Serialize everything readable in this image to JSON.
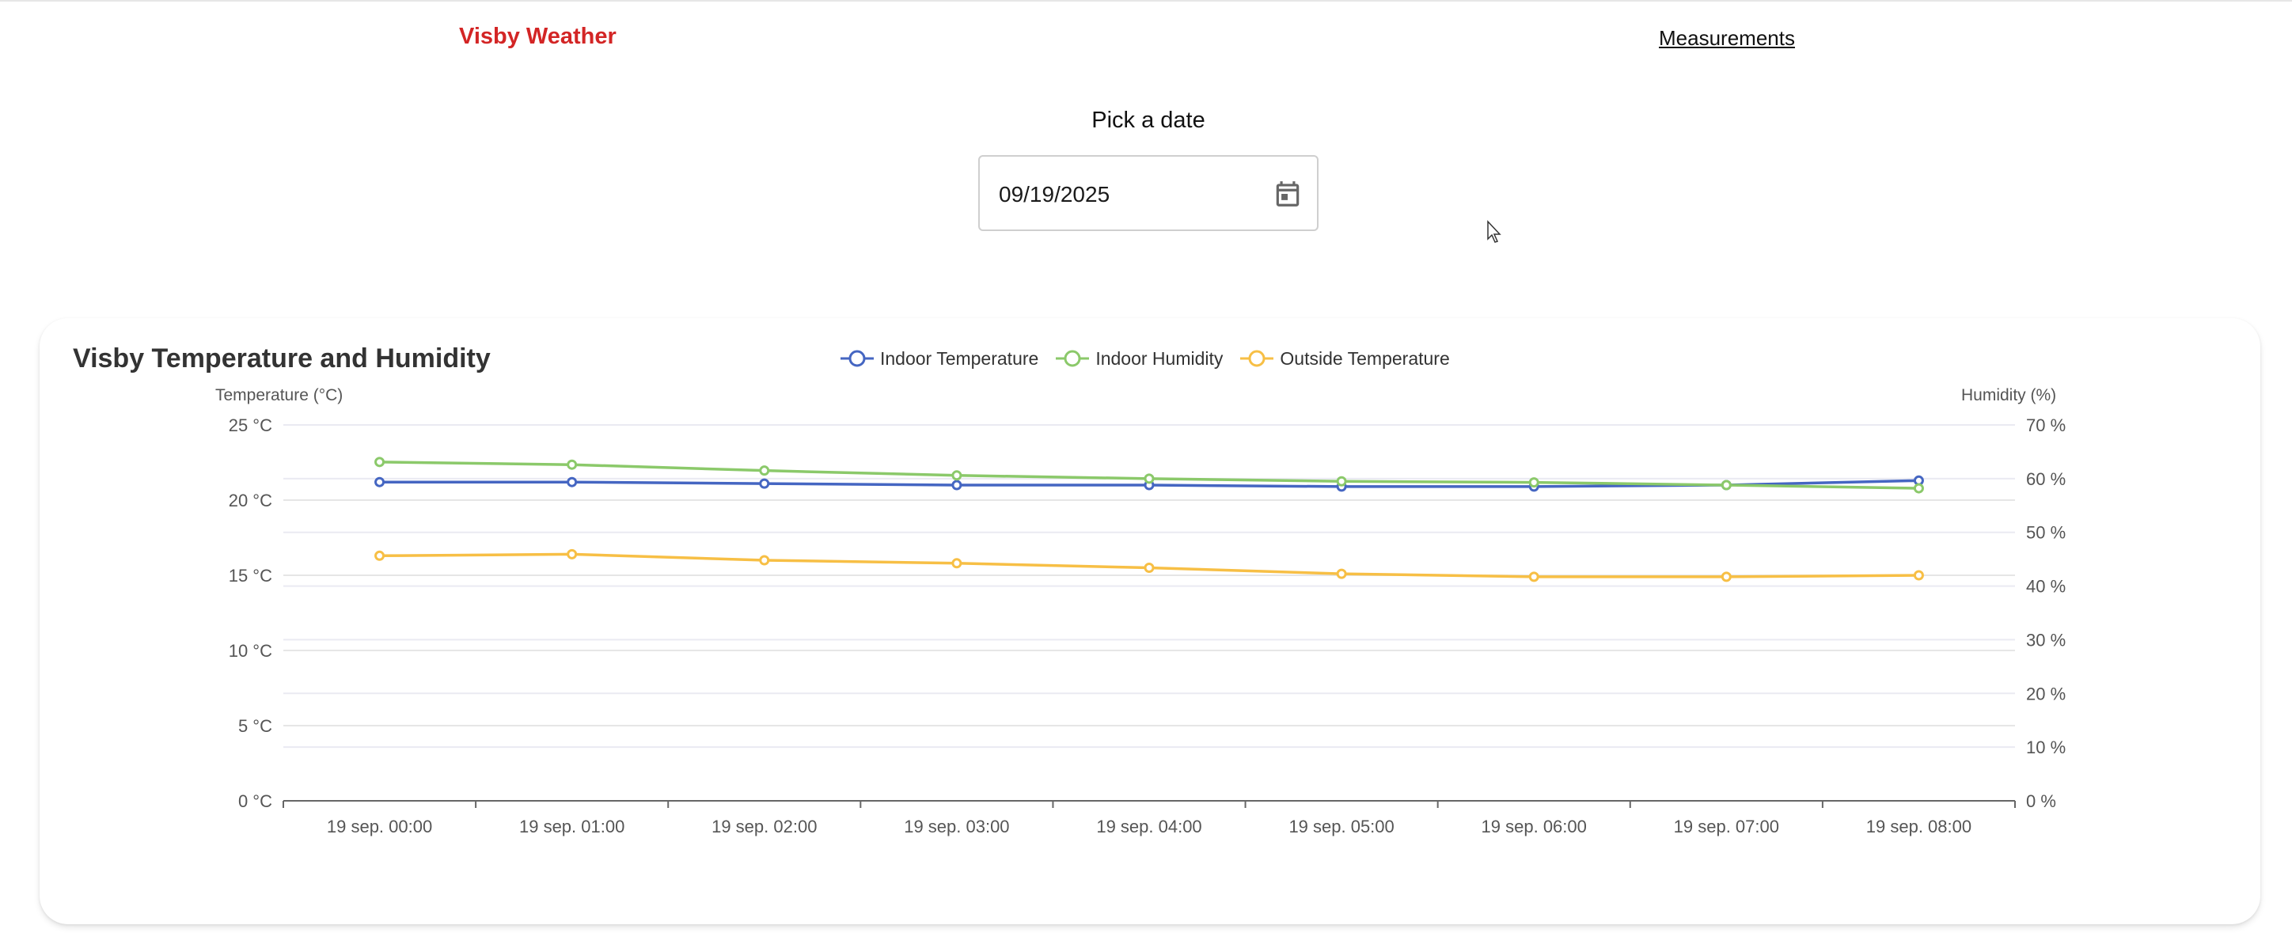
{
  "nav": {
    "brand": "Visby Weather",
    "measurements_link": "Measurements"
  },
  "date_picker": {
    "label": "Pick a date",
    "value": "09/19/2025",
    "icon": "calendar-icon"
  },
  "colors": {
    "brand": "#d32525",
    "indoor_temperature": "#4566c2",
    "indoor_humidity": "#8bc96a",
    "outside_temperature": "#f7bf45"
  },
  "chart_data": {
    "type": "line",
    "title": "Visby Temperature and Humidity",
    "x": [
      "19 sep. 00:00",
      "19 sep. 01:00",
      "19 sep. 02:00",
      "19 sep. 03:00",
      "19 sep. 04:00",
      "19 sep. 05:00",
      "19 sep. 06:00",
      "19 sep. 07:00",
      "19 sep. 08:00"
    ],
    "left_axis": {
      "label": "Temperature (°C)",
      "ticks": [
        "0 °C",
        "5 °C",
        "10 °C",
        "15 °C",
        "20 °C",
        "25 °C"
      ],
      "range": [
        0,
        25
      ]
    },
    "right_axis": {
      "label": "Humidity (%)",
      "ticks": [
        "0 %",
        "10 %",
        "20 %",
        "30 %",
        "40 %",
        "50 %",
        "60 %",
        "70 %"
      ],
      "range": [
        0,
        70
      ]
    },
    "legend_position": "top-center",
    "grid": true,
    "series": [
      {
        "name": "Indoor Temperature",
        "axis": "left",
        "color": "#4566c2",
        "values": [
          21.2,
          21.2,
          21.1,
          21.0,
          21.0,
          20.9,
          20.9,
          21.0,
          21.3
        ]
      },
      {
        "name": "Indoor Humidity",
        "axis": "right",
        "color": "#8bc96a",
        "values": [
          63.1,
          62.6,
          61.5,
          60.6,
          60.0,
          59.5,
          59.3,
          58.8,
          58.2
        ]
      },
      {
        "name": "Outside Temperature",
        "axis": "left",
        "color": "#f7bf45",
        "values": [
          16.3,
          16.4,
          16.0,
          15.8,
          15.5,
          15.1,
          14.9,
          14.9,
          15.0
        ]
      }
    ]
  }
}
